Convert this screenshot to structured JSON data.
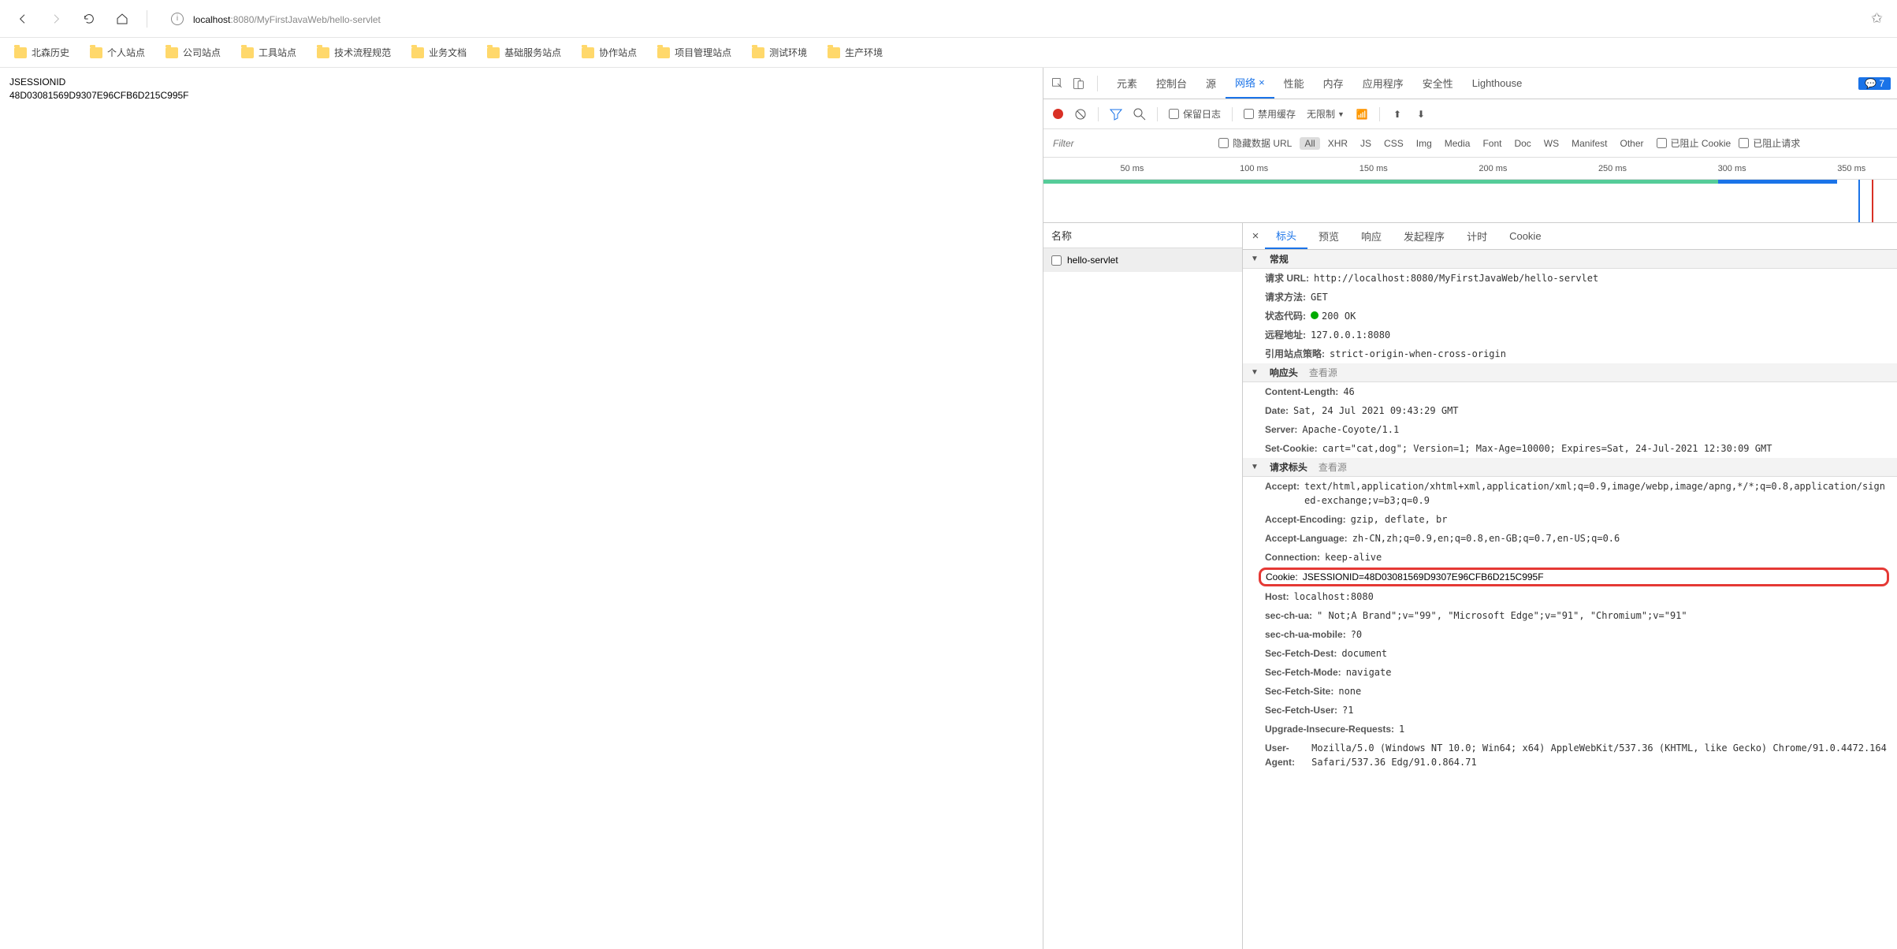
{
  "browser": {
    "url_host": "localhost",
    "url_port": ":8080",
    "url_path": "/MyFirstJavaWeb/hello-servlet",
    "bookmarks": [
      "北森历史",
      "个人站点",
      "公司站点",
      "工具站点",
      "技术流程规范",
      "业务文档",
      "基础服务站点",
      "协作站点",
      "项目管理站点",
      "测试环境",
      "生产环境"
    ]
  },
  "page_body": {
    "line1": "JSESSIONID",
    "line2": "48D03081569D9307E96CFB6D215C995F"
  },
  "devtools": {
    "tabs": [
      "元素",
      "控制台",
      "源",
      "网络",
      "性能",
      "内存",
      "应用程序",
      "安全性",
      "Lighthouse"
    ],
    "active_tab": "网络",
    "messages_badge": "7",
    "toolbar": {
      "preserve_log": "保留日志",
      "disable_cache": "禁用缓存",
      "throttle": "无限制"
    },
    "filter": {
      "placeholder": "Filter",
      "hide_data_url": "隐藏数据 URL",
      "types": [
        "All",
        "XHR",
        "JS",
        "CSS",
        "Img",
        "Media",
        "Font",
        "Doc",
        "WS",
        "Manifest",
        "Other"
      ],
      "blocked_cookies": "已阻止 Cookie",
      "blocked_requests": "已阻止请求"
    },
    "timeline_ticks": [
      "50 ms",
      "100 ms",
      "150 ms",
      "200 ms",
      "250 ms",
      "300 ms",
      "350 ms"
    ],
    "request_list": {
      "header": "名称",
      "items": [
        "hello-servlet"
      ]
    },
    "detail_tabs": [
      "标头",
      "预览",
      "响应",
      "发起程序",
      "计时",
      "Cookie"
    ],
    "sections": {
      "general": {
        "title": "常规",
        "rows": [
          {
            "k": "请求 URL:",
            "v": "http://localhost:8080/MyFirstJavaWeb/hello-servlet"
          },
          {
            "k": "请求方法:",
            "v": "GET"
          },
          {
            "k": "状态代码:",
            "v": "200 OK",
            "status": true
          },
          {
            "k": "远程地址:",
            "v": "127.0.0.1:8080"
          },
          {
            "k": "引用站点策略:",
            "v": "strict-origin-when-cross-origin"
          }
        ]
      },
      "response": {
        "title": "响应头",
        "link": "查看源",
        "rows": [
          {
            "k": "Content-Length:",
            "v": "46"
          },
          {
            "k": "Date:",
            "v": "Sat, 24 Jul 2021 09:43:29 GMT"
          },
          {
            "k": "Server:",
            "v": "Apache-Coyote/1.1"
          },
          {
            "k": "Set-Cookie:",
            "v": "cart=\"cat,dog\"; Version=1; Max-Age=10000; Expires=Sat, 24-Jul-2021 12:30:09 GMT"
          }
        ]
      },
      "request": {
        "title": "请求标头",
        "link": "查看源",
        "rows": [
          {
            "k": "Accept:",
            "v": "text/html,application/xhtml+xml,application/xml;q=0.9,image/webp,image/apng,*/*;q=0.8,application/signed-exchange;v=b3;q=0.9"
          },
          {
            "k": "Accept-Encoding:",
            "v": "gzip, deflate, br"
          },
          {
            "k": "Accept-Language:",
            "v": "zh-CN,zh;q=0.9,en;q=0.8,en-GB;q=0.7,en-US;q=0.6"
          },
          {
            "k": "Connection:",
            "v": "keep-alive"
          },
          {
            "k": "Cookie:",
            "v": "JSESSIONID=48D03081569D9307E96CFB6D215C995F",
            "highlight": true
          },
          {
            "k": "Host:",
            "v": "localhost:8080"
          },
          {
            "k": "sec-ch-ua:",
            "v": "\" Not;A Brand\";v=\"99\", \"Microsoft Edge\";v=\"91\", \"Chromium\";v=\"91\""
          },
          {
            "k": "sec-ch-ua-mobile:",
            "v": "?0"
          },
          {
            "k": "Sec-Fetch-Dest:",
            "v": "document"
          },
          {
            "k": "Sec-Fetch-Mode:",
            "v": "navigate"
          },
          {
            "k": "Sec-Fetch-Site:",
            "v": "none"
          },
          {
            "k": "Sec-Fetch-User:",
            "v": "?1"
          },
          {
            "k": "Upgrade-Insecure-Requests:",
            "v": "1"
          },
          {
            "k": "User-Agent:",
            "v": "Mozilla/5.0 (Windows NT 10.0; Win64; x64) AppleWebKit/537.36 (KHTML, like Gecko) Chrome/91.0.4472.164 Safari/537.36 Edg/91.0.864.71"
          }
        ]
      }
    }
  }
}
